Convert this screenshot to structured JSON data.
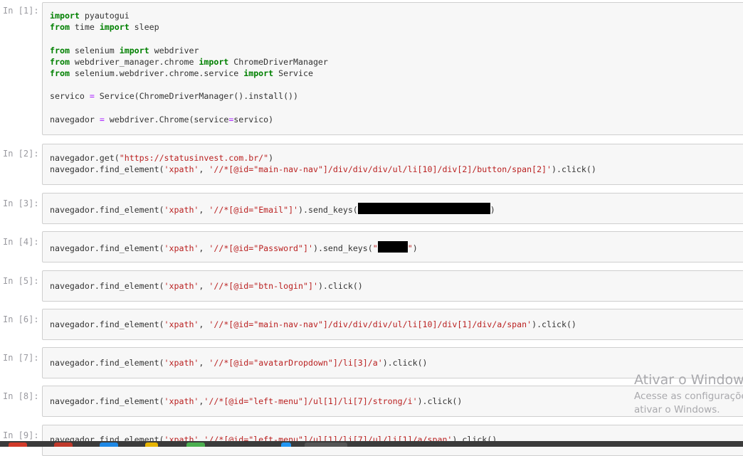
{
  "cells": [
    {
      "prompt": "In [1]:",
      "lines": [
        [
          [
            "kw",
            "import"
          ],
          [
            "t",
            " pyautogui"
          ]
        ],
        [
          [
            "kw",
            "from"
          ],
          [
            "t",
            " time "
          ],
          [
            "kw",
            "import"
          ],
          [
            "t",
            " sleep"
          ]
        ],
        [],
        [
          [
            "kw",
            "from"
          ],
          [
            "t",
            " selenium "
          ],
          [
            "kw",
            "import"
          ],
          [
            "t",
            " webdriver"
          ]
        ],
        [
          [
            "kw",
            "from"
          ],
          [
            "t",
            " webdriver_manager.chrome "
          ],
          [
            "kw",
            "import"
          ],
          [
            "t",
            " ChromeDriverManager"
          ]
        ],
        [
          [
            "kw",
            "from"
          ],
          [
            "t",
            " selenium.webdriver.chrome.service "
          ],
          [
            "kw",
            "import"
          ],
          [
            "t",
            " Service"
          ]
        ],
        [],
        [
          [
            "t",
            "servico "
          ],
          [
            "op",
            "="
          ],
          [
            "t",
            " Service(ChromeDriverManager().install())"
          ]
        ],
        [],
        [
          [
            "t",
            "navegador "
          ],
          [
            "op",
            "="
          ],
          [
            "t",
            " webdriver.Chrome(service"
          ],
          [
            "op",
            "="
          ],
          [
            "t",
            "servico)"
          ]
        ]
      ]
    },
    {
      "prompt": "In [2]:",
      "lines": [
        [
          [
            "t",
            "navegador.get("
          ],
          [
            "str",
            "\"https://statusinvest.com.br/\""
          ],
          [
            "t",
            ")"
          ]
        ],
        [
          [
            "t",
            "navegador.find_element("
          ],
          [
            "str",
            "'xpath'"
          ],
          [
            "t",
            ", "
          ],
          [
            "str",
            "'//*[@id=\"main-nav-nav\"]/div/div/div/ul/li[10]/div[2]/button/span[2]'"
          ],
          [
            "t",
            ").click()"
          ]
        ]
      ]
    },
    {
      "prompt": "In [3]:",
      "lines": [
        [
          [
            "t",
            "navegador.find_element("
          ],
          [
            "str",
            "'xpath'"
          ],
          [
            "t",
            ", "
          ],
          [
            "str",
            "'//*[@id=\"Email\"]'"
          ],
          [
            "t",
            ").send_keys("
          ],
          [
            "redact",
            "186"
          ],
          [
            "t",
            ")"
          ]
        ]
      ]
    },
    {
      "prompt": "In [4]:",
      "lines": [
        [
          [
            "t",
            "navegador.find_element("
          ],
          [
            "str",
            "'xpath'"
          ],
          [
            "t",
            ", "
          ],
          [
            "str",
            "'//*[@id=\"Password\"]'"
          ],
          [
            "t",
            ").send_keys("
          ],
          [
            "str",
            "\""
          ],
          [
            "redact",
            "42"
          ],
          [
            "str",
            "\""
          ],
          [
            "t",
            ")"
          ]
        ]
      ]
    },
    {
      "prompt": "In [5]:",
      "lines": [
        [
          [
            "t",
            "navegador.find_element("
          ],
          [
            "str",
            "'xpath'"
          ],
          [
            "t",
            ", "
          ],
          [
            "str",
            "'//*[@id=\"btn-login\"]'"
          ],
          [
            "t",
            ").click()"
          ]
        ]
      ]
    },
    {
      "prompt": "In [6]:",
      "lines": [
        [
          [
            "t",
            "navegador.find_element("
          ],
          [
            "str",
            "'xpath'"
          ],
          [
            "t",
            ", "
          ],
          [
            "str",
            "'//*[@id=\"main-nav-nav\"]/div/div/div/ul/li[10]/div[1]/div/a/span'"
          ],
          [
            "t",
            ").click()"
          ]
        ]
      ]
    },
    {
      "prompt": "In [7]:",
      "lines": [
        [
          [
            "t",
            "navegador.find_element("
          ],
          [
            "str",
            "'xpath'"
          ],
          [
            "t",
            ", "
          ],
          [
            "str",
            "'//*[@id=\"avatarDropdown\"]/li[3]/a'"
          ],
          [
            "t",
            ").click()"
          ]
        ]
      ]
    },
    {
      "prompt": "In [8]:",
      "lines": [
        [
          [
            "t",
            "navegador.find_element("
          ],
          [
            "str",
            "'xpath'"
          ],
          [
            "t",
            ","
          ],
          [
            "str",
            "'//*[@id=\"left-menu\"]/ul[1]/li[7]/strong/i'"
          ],
          [
            "t",
            ").click()"
          ]
        ]
      ]
    },
    {
      "prompt": "In [9]:",
      "lines": [
        [
          [
            "t",
            "navegador.find_element("
          ],
          [
            "str",
            "'xpath'"
          ],
          [
            "t",
            ","
          ],
          [
            "str",
            "'//*[@id=\"left-menu\"]/ul[1]/li[7]/ul/li[1]/a/span'"
          ],
          [
            "t",
            ").click()"
          ]
        ]
      ]
    }
  ],
  "watermark": {
    "title": "Ativar o Windows",
    "line1": "Acesse as configuraçõe",
    "line2": "ativar o Windows."
  },
  "colors": {
    "keyword": "#008000",
    "string": "#ba2121",
    "operator": "#aa22ff",
    "text": "#333333",
    "prompt": "#9a9aa0"
  }
}
